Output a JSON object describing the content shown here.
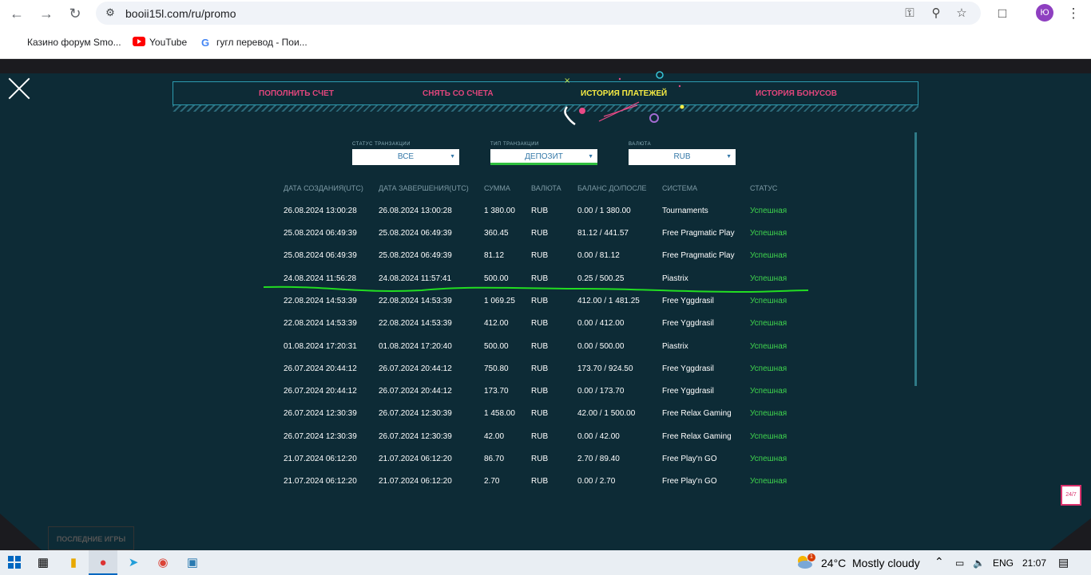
{
  "browser": {
    "url": "booii15l.com/ru/promo",
    "profile_initial": "Ю",
    "bookmarks": [
      {
        "label": "Казино форум Smo..."
      },
      {
        "label": "YouTube"
      },
      {
        "label": "гугл перевод - Пои..."
      }
    ]
  },
  "tabs": [
    {
      "label": "ПОПОЛНИТЬ СЧЕТ"
    },
    {
      "label": "СНЯТЬ СО СЧЕТА"
    },
    {
      "label": "ИСТОРИЯ ПЛАТЕЖЕЙ"
    },
    {
      "label": "ИСТОРИЯ БОНУСОВ"
    }
  ],
  "filters": {
    "status": {
      "label": "СТАТУС ТРАНЗАКЦИИ",
      "value": "ВСЕ"
    },
    "type": {
      "label": "ТИП ТРАНЗАКЦИИ",
      "value": "ДЕПОЗИТ"
    },
    "currency": {
      "label": "ВАЛЮТА",
      "value": "RUB"
    }
  },
  "table": {
    "headers": [
      "ДАТА СОЗДАНИЯ(UTC)",
      "ДАТА ЗАВЕРШЕНИЯ(UTC)",
      "СУММА",
      "ВАЛЮТА",
      "БАЛАНС ДО/ПОСЛЕ",
      "СИСТЕМА",
      "СТАТУС"
    ],
    "rows": [
      [
        "26.08.2024 13:00:28",
        "26.08.2024 13:00:28",
        "1 380.00",
        "RUB",
        "0.00 / 1 380.00",
        "Tournaments",
        "Успешная"
      ],
      [
        "25.08.2024 06:49:39",
        "25.08.2024 06:49:39",
        "360.45",
        "RUB",
        "81.12 / 441.57",
        "Free Pragmatic Play",
        "Успешная"
      ],
      [
        "25.08.2024 06:49:39",
        "25.08.2024 06:49:39",
        "81.12",
        "RUB",
        "0.00 / 81.12",
        "Free Pragmatic Play",
        "Успешная"
      ],
      [
        "24.08.2024 11:56:28",
        "24.08.2024 11:57:41",
        "500.00",
        "RUB",
        "0.25 / 500.25",
        "Piastrix",
        "Успешная"
      ],
      [
        "22.08.2024 14:53:39",
        "22.08.2024 14:53:39",
        "1 069.25",
        "RUB",
        "412.00 / 1 481.25",
        "Free Yggdrasil",
        "Успешная"
      ],
      [
        "22.08.2024 14:53:39",
        "22.08.2024 14:53:39",
        "412.00",
        "RUB",
        "0.00 / 412.00",
        "Free Yggdrasil",
        "Успешная"
      ],
      [
        "01.08.2024 17:20:31",
        "01.08.2024 17:20:40",
        "500.00",
        "RUB",
        "0.00 / 500.00",
        "Piastrix",
        "Успешная"
      ],
      [
        "26.07.2024 20:44:12",
        "26.07.2024 20:44:12",
        "750.80",
        "RUB",
        "173.70 / 924.50",
        "Free Yggdrasil",
        "Успешная"
      ],
      [
        "26.07.2024 20:44:12",
        "26.07.2024 20:44:12",
        "173.70",
        "RUB",
        "0.00 / 173.70",
        "Free Yggdrasil",
        "Успешная"
      ],
      [
        "26.07.2024 12:30:39",
        "26.07.2024 12:30:39",
        "1 458.00",
        "RUB",
        "42.00 / 1 500.00",
        "Free Relax Gaming",
        "Успешная"
      ],
      [
        "26.07.2024 12:30:39",
        "26.07.2024 12:30:39",
        "42.00",
        "RUB",
        "0.00 / 42.00",
        "Free Relax Gaming",
        "Успешная"
      ],
      [
        "21.07.2024 06:12:20",
        "21.07.2024 06:12:20",
        "86.70",
        "RUB",
        "2.70 / 89.40",
        "Free Play'n GO",
        "Успешная"
      ],
      [
        "21.07.2024 06:12:20",
        "21.07.2024 06:12:20",
        "2.70",
        "RUB",
        "0.00 / 2.70",
        "Free Play'n GO",
        "Успешная"
      ]
    ]
  },
  "page_misc": {
    "latest_games": "ПОСЛЕДНИЕ ИГРЫ",
    "support_badge": "24/7"
  },
  "taskbar": {
    "weather_badge": "1",
    "temperature": "24°C",
    "weather": "Mostly cloudy",
    "language": "ENG",
    "time": "21:07"
  },
  "colors": {
    "panel_bg": "#0d2b36",
    "tab_pink": "#e1467c",
    "tab_active": "#f7ec43",
    "status_success": "#3fd44d",
    "annotation_line": "#22dd22"
  }
}
